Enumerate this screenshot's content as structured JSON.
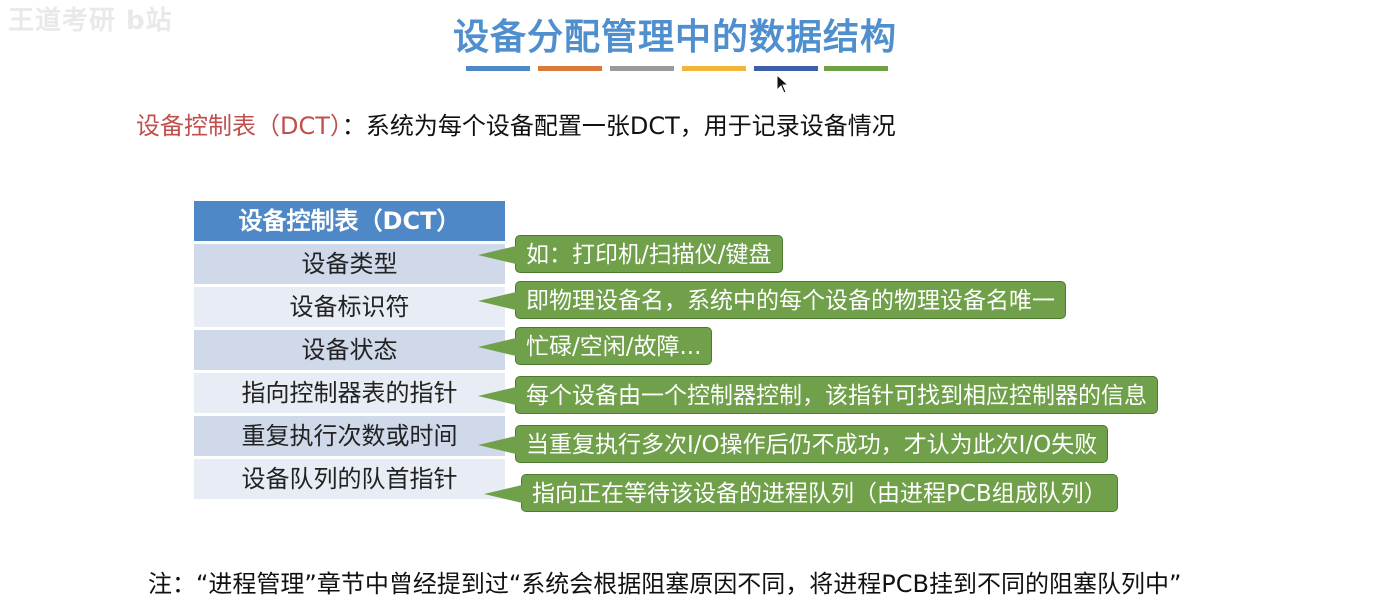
{
  "watermark": "王道考研 b站",
  "title": "设备分配管理中的数据结构",
  "colors": {
    "title": "#4f8fce",
    "bars": [
      "#4f88c6",
      "#d9793a",
      "#9a9a9a",
      "#f2b53a",
      "#3d5fa8",
      "#6ea044"
    ],
    "header": "#4f88c6",
    "callout": "#70a04a",
    "term": "#c0504d"
  },
  "definition": {
    "term": "设备控制表（DCT）",
    "text": "：系统为每个设备配置一张DCT，用于记录设备情况"
  },
  "table": {
    "header": "设备控制表（DCT）",
    "rows": [
      "设备类型",
      "设备标识符",
      "设备状态",
      "指向控制器表的指针",
      "重复执行次数或时间",
      "设备队列的队首指针"
    ]
  },
  "callouts": [
    "如：打印机/扫描仪/键盘",
    "即物理设备名，系统中的每个设备的物理设备名唯一",
    "忙碌/空闲/故障...",
    "每个设备由一个控制器控制，该指针可找到相应控制器的信息",
    "当重复执行多次I/O操作后仍不成功，才认为此次I/O失败",
    "指向正在等待该设备的进程队列（由进程PCB组成队列）"
  ],
  "note": "注：“进程管理”章节中曾经提到过“系统会根据阻塞原因不同，将进程PCB挂到不同的阻塞队列中”"
}
